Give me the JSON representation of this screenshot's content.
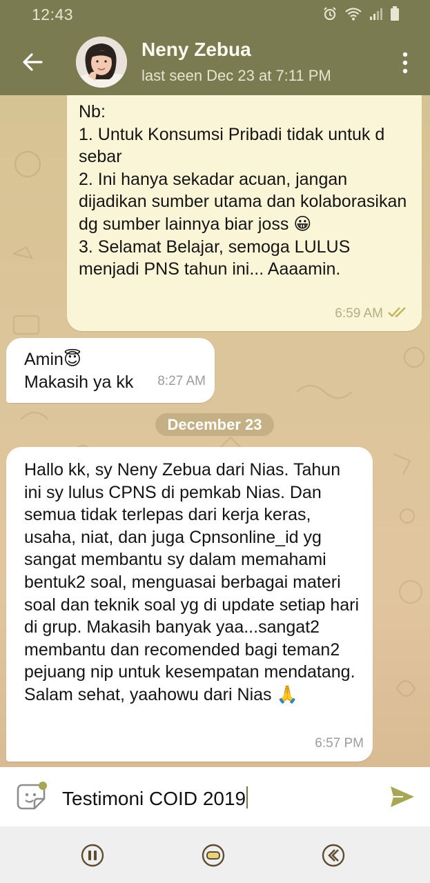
{
  "status_bar": {
    "time": "12:43",
    "icons": [
      "alarm-icon",
      "wifi-icon",
      "signal-icon",
      "battery-icon"
    ]
  },
  "header": {
    "contact_name": "Neny Zebua",
    "last_seen": "last seen Dec 23 at 7:11 PM",
    "icons": [
      "back-arrow-icon",
      "avatar",
      "more-vert-icon"
    ]
  },
  "messages": [
    {
      "direction": "outgoing",
      "text": "Nb:\n1. Untuk Konsumsi Pribadi tidak untuk d sebar\n2. Ini hanya sekadar acuan, jangan dijadikan sumber utama dan kolaborasikan dg sumber lainnya biar joss 😀\n3. Selamat Belajar, semoga LULUS menjadi PNS tahun ini... Aaaamin.",
      "time": "6:59 AM",
      "status": "read-double-check"
    },
    {
      "direction": "incoming",
      "text": "Amin😇\nMakasih ya kk",
      "time": "8:27 AM"
    },
    {
      "direction": "incoming",
      "text": "Hallo kk, sy Neny Zebua dari Nias. Tahun ini sy lulus CPNS di pemkab Nias. Dan semua tidak terlepas dari kerja keras, usaha, niat, dan juga Cpnsonline_id yg sangat membantu sy dalam memahami bentuk2 soal, menguasai berbagai materi soal dan teknik soal yg di update setiap hari di grup. Makasih banyak yaa...sangat2 membantu dan recomended bagi teman2 pejuang nip untuk kesempatan mendatang. Salam sehat, yaahowu dari Nias 🙏",
      "time": "6:57 PM"
    }
  ],
  "date_separator": "December 23",
  "composer": {
    "text": "Testimoni COID 2019",
    "icons": [
      "sticker-icon",
      "send-icon"
    ]
  },
  "nav_bar": {
    "icons": [
      "recent-apps-icon",
      "home-icon",
      "back-icon"
    ]
  },
  "colors": {
    "app_bar": "#7b7b52",
    "outgoing_bubble": "#fbf5d8",
    "incoming_bubble": "#ffffff",
    "chat_background": "#dcc59a",
    "date_chip": "#c4b084",
    "read_check": "#c2b45a",
    "send_button": "#a7a655"
  }
}
